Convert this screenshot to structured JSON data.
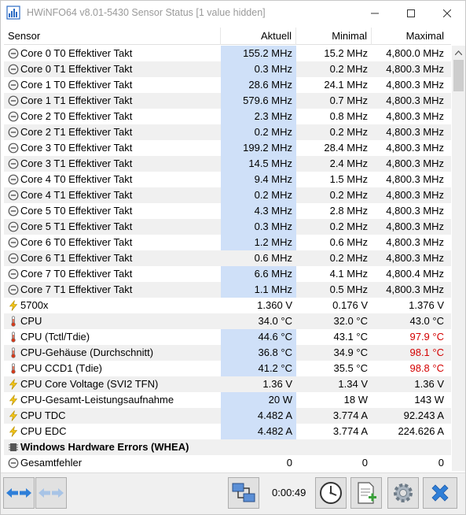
{
  "window": {
    "title": "HWiNFO64 v8.01-5430 Sensor Status [1 value hidden]"
  },
  "columns": [
    "Sensor",
    "Aktuell",
    "Minimal",
    "Maximal"
  ],
  "rows": [
    {
      "icon": "clock-gauge-icon",
      "name": "Core 0 T0 Effektiver Takt",
      "current": "155.2 MHz",
      "min": "15.2 MHz",
      "max": "4,800.0 MHz",
      "hl": true
    },
    {
      "icon": "clock-gauge-icon",
      "name": "Core 0 T1 Effektiver Takt",
      "current": "0.3 MHz",
      "min": "0.2 MHz",
      "max": "4,800.3 MHz",
      "hl": true
    },
    {
      "icon": "clock-gauge-icon",
      "name": "Core 1 T0 Effektiver Takt",
      "current": "28.6 MHz",
      "min": "24.1 MHz",
      "max": "4,800.3 MHz",
      "hl": true
    },
    {
      "icon": "clock-gauge-icon",
      "name": "Core 1 T1 Effektiver Takt",
      "current": "579.6 MHz",
      "min": "0.7 MHz",
      "max": "4,800.3 MHz",
      "hl": true
    },
    {
      "icon": "clock-gauge-icon",
      "name": "Core 2 T0 Effektiver Takt",
      "current": "2.3 MHz",
      "min": "0.8 MHz",
      "max": "4,800.3 MHz",
      "hl": true
    },
    {
      "icon": "clock-gauge-icon",
      "name": "Core 2 T1 Effektiver Takt",
      "current": "0.2 MHz",
      "min": "0.2 MHz",
      "max": "4,800.3 MHz",
      "hl": true
    },
    {
      "icon": "clock-gauge-icon",
      "name": "Core 3 T0 Effektiver Takt",
      "current": "199.2 MHz",
      "min": "28.4 MHz",
      "max": "4,800.3 MHz",
      "hl": true
    },
    {
      "icon": "clock-gauge-icon",
      "name": "Core 3 T1 Effektiver Takt",
      "current": "14.5 MHz",
      "min": "2.4 MHz",
      "max": "4,800.3 MHz",
      "hl": true
    },
    {
      "icon": "clock-gauge-icon",
      "name": "Core 4 T0 Effektiver Takt",
      "current": "9.4 MHz",
      "min": "1.5 MHz",
      "max": "4,800.3 MHz",
      "hl": true
    },
    {
      "icon": "clock-gauge-icon",
      "name": "Core 4 T1 Effektiver Takt",
      "current": "0.2 MHz",
      "min": "0.2 MHz",
      "max": "4,800.3 MHz",
      "hl": true
    },
    {
      "icon": "clock-gauge-icon",
      "name": "Core 5 T0 Effektiver Takt",
      "current": "4.3 MHz",
      "min": "2.8 MHz",
      "max": "4,800.3 MHz",
      "hl": true
    },
    {
      "icon": "clock-gauge-icon",
      "name": "Core 5 T1 Effektiver Takt",
      "current": "0.3 MHz",
      "min": "0.2 MHz",
      "max": "4,800.3 MHz",
      "hl": true
    },
    {
      "icon": "clock-gauge-icon",
      "name": "Core 6 T0 Effektiver Takt",
      "current": "1.2 MHz",
      "min": "0.6 MHz",
      "max": "4,800.3 MHz",
      "hl": true
    },
    {
      "icon": "clock-gauge-icon",
      "name": "Core 6 T1 Effektiver Takt",
      "current": "0.6 MHz",
      "min": "0.2 MHz",
      "max": "4,800.3 MHz",
      "hl": false
    },
    {
      "icon": "clock-gauge-icon",
      "name": "Core 7 T0 Effektiver Takt",
      "current": "6.6 MHz",
      "min": "4.1 MHz",
      "max": "4,800.4 MHz",
      "hl": true
    },
    {
      "icon": "clock-gauge-icon",
      "name": "Core 7 T1 Effektiver Takt",
      "current": "1.1 MHz",
      "min": "0.5 MHz",
      "max": "4,800.3 MHz",
      "hl": true
    },
    {
      "icon": "voltage-bolt-icon",
      "name": "5700x",
      "current": "1.360 V",
      "min": "0.176 V",
      "max": "1.376 V",
      "hl": false
    },
    {
      "icon": "thermometer-icon",
      "name": "CPU",
      "current": "34.0 °C",
      "min": "32.0 °C",
      "max": "43.0 °C",
      "hl": false
    },
    {
      "icon": "thermometer-icon",
      "name": "CPU (Tctl/Tdie)",
      "current": "44.6 °C",
      "min": "43.1 °C",
      "max": "97.9 °C",
      "hl": true,
      "maxRed": true
    },
    {
      "icon": "thermometer-icon",
      "name": "CPU-Gehäuse (Durchschnitt)",
      "current": "36.8 °C",
      "min": "34.9 °C",
      "max": "98.1 °C",
      "hl": true,
      "maxRed": true
    },
    {
      "icon": "thermometer-icon",
      "name": "CPU CCD1 (Tdie)",
      "current": "41.2 °C",
      "min": "35.5 °C",
      "max": "98.8 °C",
      "hl": true,
      "maxRed": true
    },
    {
      "icon": "voltage-bolt-icon",
      "name": "CPU Core Voltage (SVI2 TFN)",
      "current": "1.36 V",
      "min": "1.34 V",
      "max": "1.36 V",
      "hl": false
    },
    {
      "icon": "power-bolt-icon",
      "name": "CPU-Gesamt-Leistungsaufnahme",
      "current": "20 W",
      "min": "18 W",
      "max": "143 W",
      "hl": true
    },
    {
      "icon": "current-bolt-icon",
      "name": "CPU TDC",
      "current": "4.482 A",
      "min": "3.774 A",
      "max": "92.243 A",
      "hl": true
    },
    {
      "icon": "current-bolt-icon",
      "name": "CPU EDC",
      "current": "4.482 A",
      "min": "3.774 A",
      "max": "224.626 A",
      "hl": true
    },
    {
      "icon": "chip-icon",
      "name": "Windows Hardware Errors (WHEA)",
      "group": true
    },
    {
      "icon": "error-icon",
      "name": "Gesamtfehler",
      "current": "0",
      "min": "0",
      "max": "0",
      "hl": false
    }
  ],
  "toolbar": {
    "timer": "0:00:49"
  },
  "colors": {
    "highlight": "#cfe0f8",
    "alert": "#d40000"
  }
}
